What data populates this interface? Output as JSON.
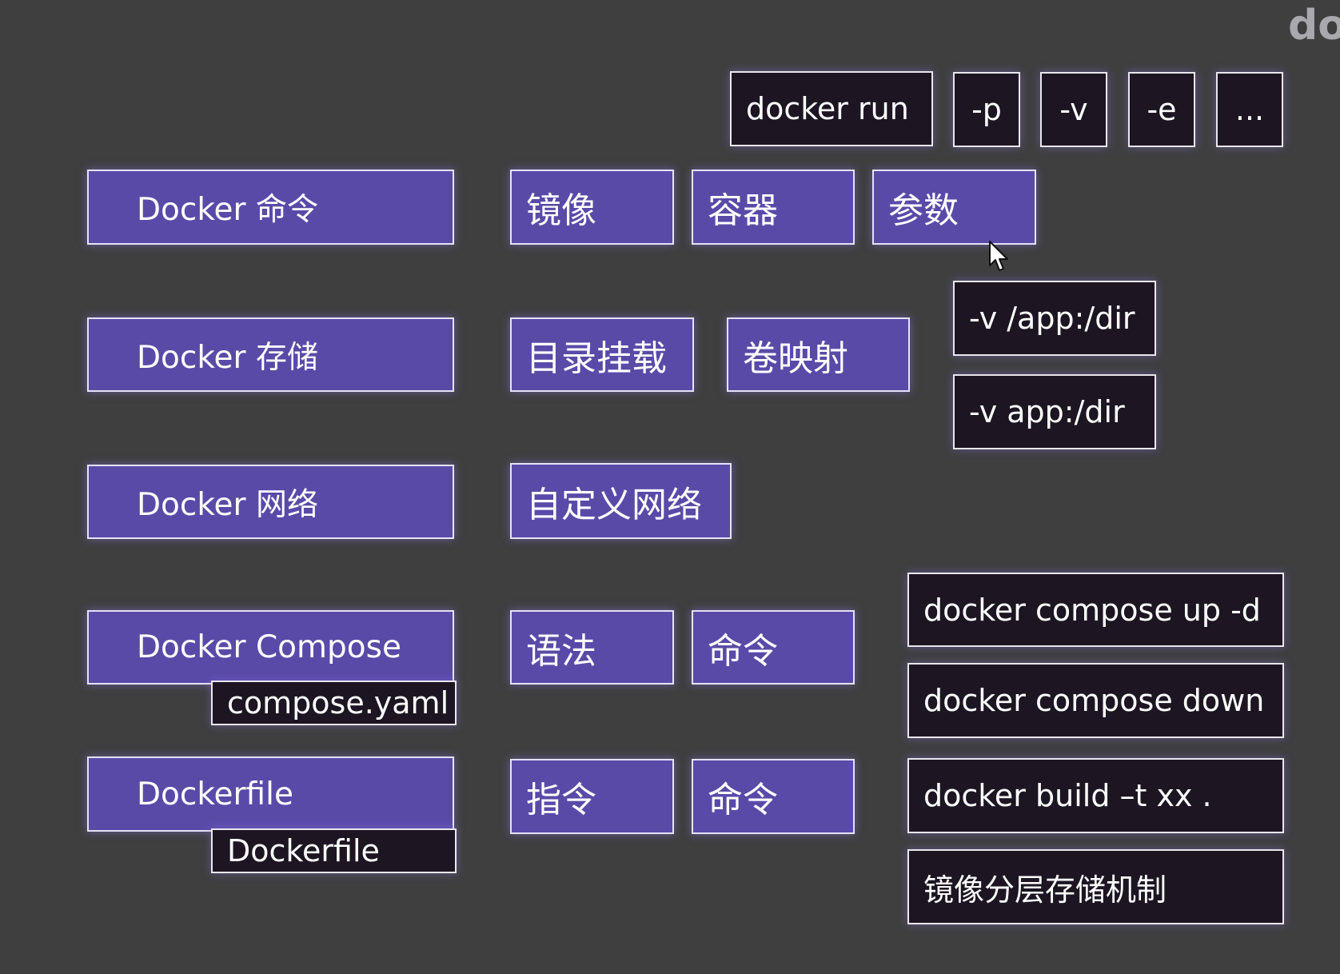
{
  "corner_text": "do",
  "categories": [
    {
      "id": "commands",
      "label": "Docker 命令"
    },
    {
      "id": "storage",
      "label": "Docker 存储"
    },
    {
      "id": "network",
      "label": "Docker 网络"
    },
    {
      "id": "compose",
      "label": "Docker Compose"
    },
    {
      "id": "dockerfile",
      "label": "Dockerfile"
    }
  ],
  "file_tags": {
    "compose": "compose.yaml",
    "dockerfile": "Dockerfile"
  },
  "subtopics": {
    "commands": [
      "镜像",
      "容器",
      "参数"
    ],
    "storage": [
      "目录挂载",
      "卷映射"
    ],
    "network": [
      "自定义网络"
    ],
    "compose": [
      "语法",
      "命令"
    ],
    "dockerfile": [
      "指令",
      "命令"
    ]
  },
  "run_command": {
    "label": "docker run",
    "flags": [
      "-p",
      "-v",
      "-e",
      "..."
    ]
  },
  "volume_examples": [
    "-v /app:/dir",
    "-v app:/dir"
  ],
  "compose_commands": [
    "docker compose up -d",
    "docker compose down"
  ],
  "build_items": [
    "docker build –t xx .",
    "镜像分层存储机制"
  ],
  "colors": {
    "background": "#3f3f40",
    "topic_fill": "#5a4aa8",
    "command_fill": "#1d1622",
    "border": "#e6e2f4",
    "text": "#ffffff"
  }
}
